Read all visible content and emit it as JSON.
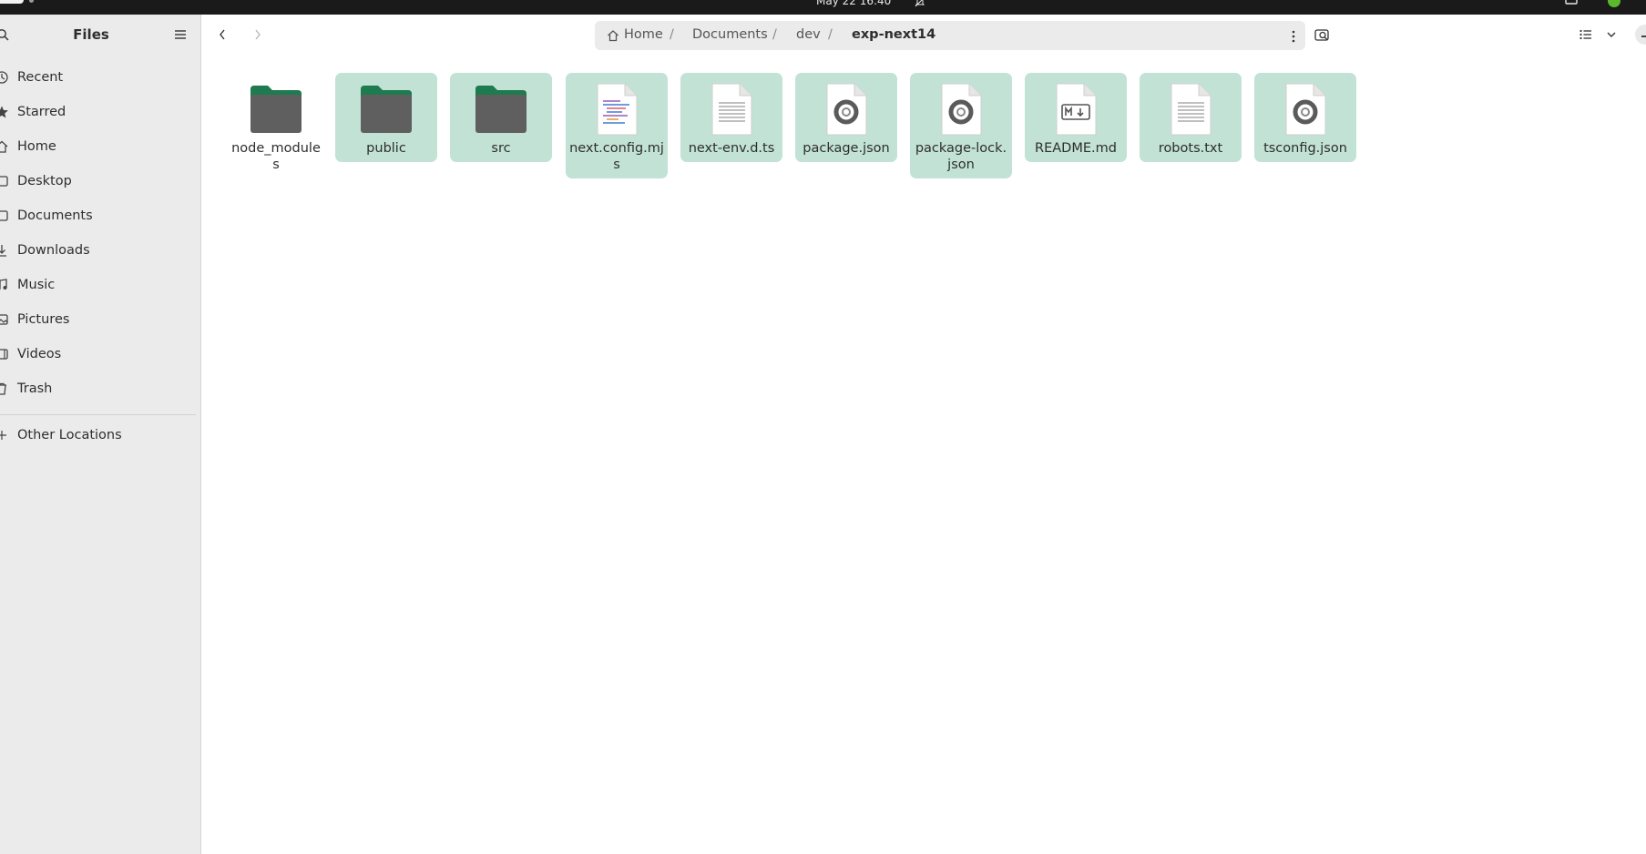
{
  "topbar": {
    "clock": "May 22  16:40"
  },
  "sidebar": {
    "title": "Files",
    "items": [
      {
        "label": "Recent",
        "icon": "clock-icon"
      },
      {
        "label": "Starred",
        "icon": "star-icon"
      },
      {
        "label": "Home",
        "icon": "home-icon"
      },
      {
        "label": "Desktop",
        "icon": "desktop-icon"
      },
      {
        "label": "Documents",
        "icon": "document-icon"
      },
      {
        "label": "Downloads",
        "icon": "download-icon"
      },
      {
        "label": "Music",
        "icon": "music-icon"
      },
      {
        "label": "Pictures",
        "icon": "picture-icon"
      },
      {
        "label": "Videos",
        "icon": "video-icon"
      },
      {
        "label": "Trash",
        "icon": "trash-icon"
      }
    ],
    "other_locations": "Other Locations"
  },
  "pathbar": {
    "crumbs": [
      "Home",
      "Documents",
      "dev",
      "exp-next14"
    ],
    "separator": "/"
  },
  "files": [
    {
      "name": "node_modules",
      "type": "folder",
      "selected": false
    },
    {
      "name": "public",
      "type": "folder",
      "selected": true
    },
    {
      "name": "src",
      "type": "folder",
      "selected": true
    },
    {
      "name": "next.config.mjs",
      "type": "script",
      "selected": true
    },
    {
      "name": "next-env.d.ts",
      "type": "text",
      "selected": true
    },
    {
      "name": "package.json",
      "type": "json",
      "selected": true
    },
    {
      "name": "package-lock.json",
      "type": "json",
      "selected": true
    },
    {
      "name": "README.md",
      "type": "markdown",
      "selected": true
    },
    {
      "name": "robots.txt",
      "type": "text",
      "selected": true
    },
    {
      "name": "tsconfig.json",
      "type": "json",
      "selected": true
    }
  ],
  "colors": {
    "selection": "#c2e2d6",
    "folder_tab": "#1e7a4f",
    "folder_body": "#5f5f5f",
    "sidebar_bg": "#ebebeb",
    "topbar_bg": "#1a1a1a"
  }
}
